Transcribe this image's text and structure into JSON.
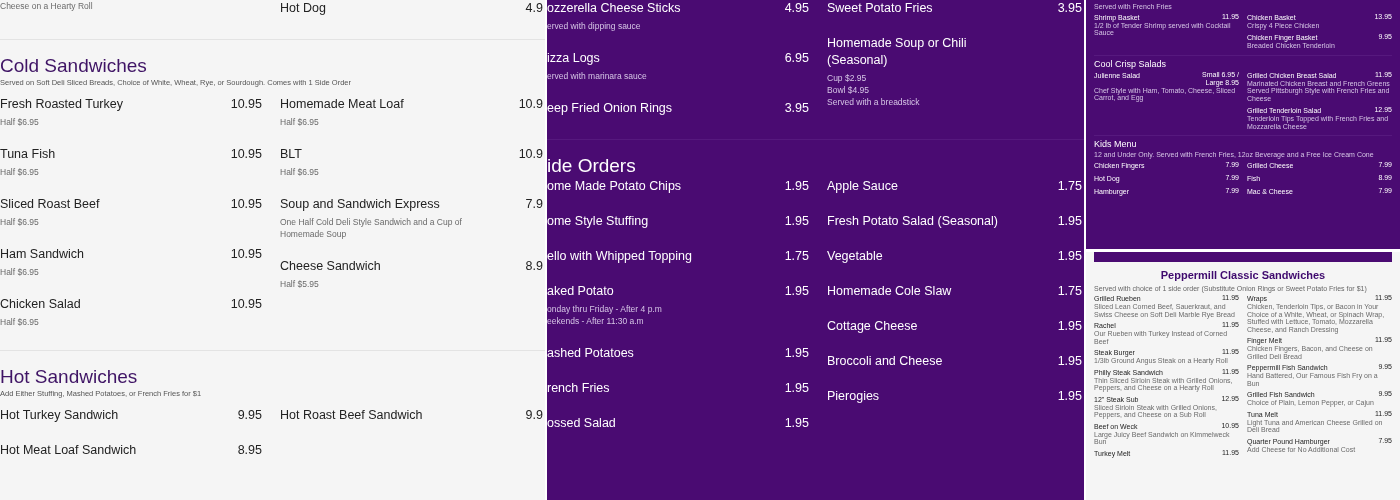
{
  "panels": [
    {
      "sections": [
        {
          "columns": [
            [
              {
                "details": [
                  "Cheese on a Hearty Roll"
                ]
              }
            ],
            [
              {
                "name": "Hot Dog",
                "price": "4.9"
              }
            ]
          ]
        },
        {
          "title": "Cold Sandwiches",
          "note": "Served on Soft Deli Sliced Breads, Choice of White, Wheat, Rye, or Sourdough. Comes with 1 Side Order",
          "columns": [
            [
              {
                "name": "Fresh Roasted Turkey",
                "price": "10.95",
                "details": [
                  "Half $6.95"
                ]
              },
              {
                "name": "Tuna Fish",
                "price": "10.95",
                "details": [
                  "Half $6.95"
                ]
              },
              {
                "name": "Sliced Roast Beef",
                "price": "10.95",
                "details": [
                  "Half $6.95"
                ]
              },
              {
                "name": "Ham Sandwich",
                "price": "10.95",
                "details": [
                  "Half $6.95"
                ]
              },
              {
                "name": "Chicken Salad",
                "price": "10.95",
                "details": [
                  "Half $6.95"
                ]
              }
            ],
            [
              {
                "name": "Homemade Meat Loaf",
                "price": "10.9",
                "details": [
                  "Half $6.95"
                ]
              },
              {
                "name": "BLT",
                "price": "10.9",
                "details": [
                  "Half $6.95"
                ]
              },
              {
                "name": "Soup and Sandwich Express",
                "price": "7.9",
                "details": [
                  "One Half Cold Deli Style Sandwich and a Cup of Homemade Soup"
                ]
              },
              {
                "name": "Cheese Sandwich",
                "price": "8.9",
                "details": [
                  "Half $5.95"
                ]
              }
            ]
          ]
        },
        {
          "title": "Hot Sandwiches",
          "note": "Add Either Stuffing, Mashed Potatoes, or French Fries for $1",
          "columns": [
            [
              {
                "name": "Hot Turkey Sandwich",
                "price": "9.95"
              },
              {
                "name": "Hot Meat Loaf Sandwich",
                "price": "8.95"
              }
            ],
            [
              {
                "name": "Hot Roast Beef Sandwich",
                "price": "9.9"
              }
            ]
          ]
        }
      ]
    },
    {
      "sections": [
        {
          "columns": [
            [
              {
                "name": "ozzerella Cheese Sticks",
                "price": "4.95",
                "details": [
                  "erved with dipping sauce"
                ]
              },
              {
                "name": "izza Logs",
                "price": "6.95",
                "details": [
                  "erved with marinara sauce"
                ]
              },
              {
                "name": "eep Fried Onion Rings",
                "price": "3.95"
              }
            ],
            [
              {
                "name": "Sweet Potato Fries",
                "price": "3.95"
              },
              {
                "name": "Homemade Soup or Chili\n(Seasonal)",
                "details": [
                  "Cup $2.95",
                  "Bowl $4.95",
                  "Served with a breadstick"
                ]
              }
            ]
          ]
        },
        {
          "title": "ide Orders",
          "columns": [
            [
              {
                "name": "ome Made Potato Chips",
                "price": "1.95"
              },
              {
                "name": "ome Style Stuffing",
                "price": "1.95"
              },
              {
                "name": "ello with Whipped Topping",
                "price": "1.75"
              },
              {
                "name": "aked Potato",
                "price": "1.95",
                "details": [
                  "onday thru Friday - After 4 p.m",
                  "eekends - After 11:30 a.m"
                ]
              },
              {
                "name": "ashed Potatoes",
                "price": "1.95"
              },
              {
                "name": "rench Fries",
                "price": "1.95"
              },
              {
                "name": "ossed Salad",
                "price": "1.95"
              }
            ],
            [
              {
                "name": "Apple Sauce",
                "price": "1.75"
              },
              {
                "name": "Fresh Potato Salad (Seasonal)",
                "price": "1.95"
              },
              {
                "name": "Vegetable",
                "price": "1.95"
              },
              {
                "name": "Homemade Cole Slaw",
                "price": "1.75"
              },
              {
                "name": "Cottage Cheese",
                "price": "1.95"
              },
              {
                "name": "Broccoli and Cheese",
                "price": "1.95"
              },
              {
                "name": "Pierogies",
                "price": "1.95"
              }
            ]
          ]
        }
      ]
    },
    {
      "sections": [
        {
          "note": "Served with French Fries",
          "columns": [
            [
              {
                "name": "Shrimp Basket",
                "price": "11.95",
                "details": [
                  "1/2 lb of Tender Shrimp served with Cocktail Sauce"
                ]
              }
            ],
            [
              {
                "name": "Chicken Basket",
                "price": "13.95",
                "details": [
                  "Crispy 4 Piece Chicken"
                ]
              },
              {
                "name": "Chicken Finger Basket",
                "price": "9.95",
                "details": [
                  "Breaded Chicken Tenderloin"
                ]
              }
            ]
          ]
        },
        {
          "title": "Cool Crisp Salads",
          "columns": [
            [
              {
                "name": "Julienne Salad",
                "price": "Small 6.95 / Large 8.95",
                "details": [
                  "Chef Style with Ham, Tomato, Cheese, Sliced Carrot, and Egg"
                ]
              }
            ],
            [
              {
                "name": "Grilled Chicken Breast Salad",
                "price": "11.95",
                "details": [
                  "Marinated Chicken Breast and French Greens Served Pittsburgh Style with French Fries and Cheese"
                ]
              },
              {
                "name": "Grilled Tenderloin Salad",
                "price": "12.95",
                "details": [
                  "Tenderloin Tips Topped with French Fries and Mozzarella Cheese"
                ]
              }
            ]
          ]
        },
        {
          "title": "Kids Menu",
          "note": "12 and Under Only. Served with French Fries, 12oz Beverage and a Free Ice Cream Cone",
          "columns": [
            [
              {
                "name": "Chicken Fingers",
                "price": "7.99"
              },
              {
                "name": "Hot Dog",
                "price": "7.99"
              },
              {
                "name": "Hamburger",
                "price": "7.99"
              }
            ],
            [
              {
                "name": "Grilled Cheese",
                "price": "7.99"
              },
              {
                "name": "Fish",
                "price": "8.99"
              },
              {
                "name": "Mac & Cheese",
                "price": "7.99"
              }
            ]
          ]
        }
      ]
    },
    {
      "sections": [
        {
          "title": "Peppermill Classic Sandwiches",
          "note": "Served with choice of 1 side order (Substitute Onion Rings or Sweet Potato Fries for $1)",
          "columns": [
            [
              {
                "name": "Grilled Rueben",
                "price": "11.95",
                "details": [
                  "Sliced Lean Corned Beef, Sauerkraut, and Swiss Cheese on Soft Deli Marble Rye Bread"
                ]
              },
              {
                "name": "Rachel",
                "price": "11.95",
                "details": [
                  "Our Rueben with Turkey Instead of Corned Beef"
                ]
              },
              {
                "name": "Steak Burger",
                "price": "11.95",
                "details": [
                  "1/3lb Ground Angus Steak on a Hearty Roll"
                ]
              },
              {
                "name": "Philly Steak Sandwich",
                "price": "11.95",
                "details": [
                  "Thin Sliced Sirloin Steak with Grilled Onions, Peppers, and Cheese on a Hearty Roll"
                ]
              },
              {
                "name": "12\" Steak Sub",
                "price": "12.95",
                "details": [
                  "Sliced Sirloin Steak with Grilled Onions, Peppers, and Cheese on a Sub Roll"
                ]
              },
              {
                "name": "Beef on Weck",
                "price": "10.95",
                "details": [
                  "Large Juicy Beef Sandwich on Kimmelweck Bun"
                ]
              },
              {
                "name": "Turkey Melt",
                "price": "11.95"
              }
            ],
            [
              {
                "name": "Wraps",
                "price": "11.95",
                "details": [
                  "Chicken, Tenderloin Tips, or Bacon in Your Choice of a White, Wheat, or Spinach Wrap, Stuffed with Lettuce, Tomato, Mozzarella Cheese, and Ranch Dressing"
                ]
              },
              {
                "name": "Finger Melt",
                "price": "11.95",
                "details": [
                  "Chicken Fingers, Bacon, and Cheese on Grilled Deli Bread"
                ]
              },
              {
                "name": "Peppermill Fish Sandwich",
                "price": "9.95",
                "details": [
                  "Hand Battered, Our Famous Fish Fry on a Bun"
                ]
              },
              {
                "name": "Grilled Fish Sandwich",
                "price": "9.95",
                "details": [
                  "Choice of Plain, Lemon Pepper, or Cajun"
                ]
              },
              {
                "name": "Tuna Melt",
                "price": "11.95",
                "details": [
                  "Light Tuna and American Cheese Grilled on Deli Bread"
                ]
              },
              {
                "name": "Quarter Pound Hamburger",
                "price": "7.95",
                "details": [
                  "Add Cheese for No Additional Cost"
                ]
              }
            ]
          ]
        }
      ]
    }
  ]
}
